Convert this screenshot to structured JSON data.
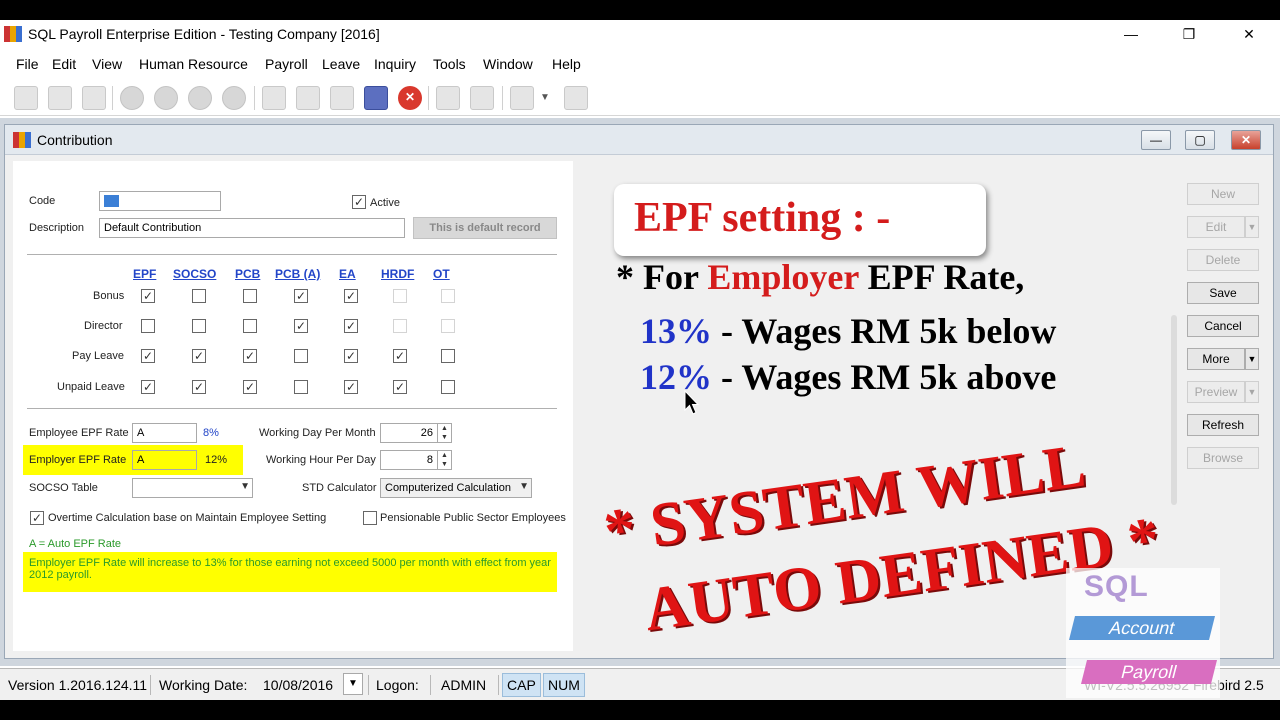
{
  "window": {
    "title": "SQL Payroll Enterprise Edition - Testing Company [2016]",
    "minimize": "—",
    "restore": "❐",
    "close": "✕"
  },
  "menu": [
    "File",
    "Edit",
    "View",
    "Human Resource",
    "Payroll",
    "Leave",
    "Inquiry",
    "Tools",
    "Window",
    "Help"
  ],
  "child_window": {
    "title": "Contribution",
    "minimize": "—",
    "maximize": "▢",
    "close": "✕"
  },
  "form": {
    "code_label": "Code",
    "code_value": "----",
    "active_label": "Active",
    "active_checked": true,
    "description_label": "Description",
    "description_value": "Default Contribution",
    "default_record_button": "This is default record",
    "columns": [
      "EPF",
      "SOCSO",
      "PCB",
      "PCB (A)",
      "EA",
      "HRDF",
      "OT"
    ],
    "rows": [
      {
        "label": "Bonus",
        "checks": [
          true,
          false,
          false,
          true,
          true,
          null,
          null
        ]
      },
      {
        "label": "Director",
        "checks": [
          false,
          false,
          false,
          true,
          true,
          null,
          null
        ]
      },
      {
        "label": "Pay Leave",
        "checks": [
          true,
          true,
          true,
          false,
          true,
          true,
          false
        ]
      },
      {
        "label": "Unpaid Leave",
        "checks": [
          true,
          true,
          true,
          false,
          true,
          true,
          false
        ]
      }
    ],
    "employee_epf_label": "Employee EPF Rate",
    "employee_epf_value": "A",
    "employee_epf_pct": "8%",
    "employer_epf_label": "Employer EPF Rate",
    "employer_epf_value": "A",
    "employer_epf_pct": "12%",
    "working_day_label": "Working Day Per Month",
    "working_day_value": "26",
    "working_hour_label": "Working Hour Per Day",
    "working_hour_value": "8",
    "socso_label": "SOCSO Table",
    "socso_value": "",
    "std_calc_label": "STD Calculator",
    "std_calc_value": "Computerized Calculation",
    "overtime_label": "Overtime Calculation base on Maintain Employee Setting",
    "overtime_checked": true,
    "pensionable_label": "Pensionable Public Sector Employees",
    "pensionable_checked": false,
    "auto_note": "A = Auto EPF Rate",
    "info_note": "Employer EPF Rate will increase to 13% for those earning not exceed 5000 per month with effect from year 2012 payroll."
  },
  "side_buttons": {
    "new": "New",
    "edit": "Edit",
    "delete": "Delete",
    "save": "Save",
    "cancel": "Cancel",
    "more": "More",
    "preview": "Preview",
    "refresh": "Refresh",
    "browse": "Browse"
  },
  "overlay": {
    "title": "EPF setting : -",
    "line1_prefix": "* For ",
    "line1_highlight": "Employer",
    "line1_suffix": " EPF Rate,",
    "line2_pct": "13%",
    "line2_text": " - Wages RM 5k below",
    "line3_pct": "12%",
    "line3_text": " - Wages RM 5k above",
    "banner_line1": "* SYSTEM WILL",
    "banner_line2": "AUTO DEFINED *"
  },
  "logo": {
    "sql": "SQL",
    "account": "Account",
    "payroll": "Payroll"
  },
  "status": {
    "version": "Version 1.2016.124.11",
    "working_date_label": "Working Date:",
    "working_date": "10/08/2016",
    "logon_label": "Logon:",
    "user": "ADMIN",
    "cap": "CAP",
    "num": "NUM",
    "db": "WI-V2.5.5.26952 Firebird 2.5"
  },
  "colors": {
    "highlight_yellow": "#ffff00",
    "overlay_red": "#d41c1c",
    "overlay_blue": "#2033c8",
    "column_blue": "#2245c8"
  }
}
